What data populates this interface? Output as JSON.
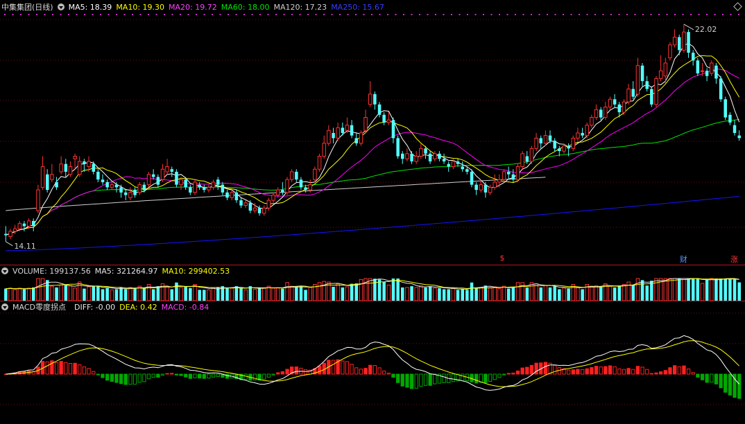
{
  "stock": {
    "name": "中集集团",
    "period": "(日线)"
  },
  "colors": {
    "bg": "#000000",
    "up": "#ff3232",
    "down": "#54ffff",
    "grid": "#7a0d12",
    "ma5": "#ffffff",
    "ma10": "#ffff00",
    "ma20": "#ff00ff",
    "ma60": "#00e600",
    "ma120": "#d0d0d0",
    "ma250": "#1414ff",
    "macd_up": "#ff2020",
    "macd_down": "#00a800",
    "diff": "#ffffff",
    "dea": "#ffff00"
  },
  "price_legend": [
    {
      "label": "MA5: 18.39",
      "color": "#ffffff"
    },
    {
      "label": "MA10: 19.30",
      "color": "#ffff00"
    },
    {
      "label": "MA20: 19.72",
      "color": "#ff40ff"
    },
    {
      "label": "MA60: 18.00",
      "color": "#00e600"
    },
    {
      "label": "MA120: 17.23",
      "color": "#d0d0d0"
    },
    {
      "label": "MA250: 15.67",
      "color": "#3c3cff"
    }
  ],
  "volume_legend": {
    "title": "VOLUME: 199137.56",
    "ma5": "MA5: 321264.97",
    "ma10": "MA10: 299402.53"
  },
  "macd_legend": {
    "title": "MACD零度拐点",
    "diff": "DIFF: -0.00",
    "dea": "DEA: 0.42",
    "macd": "MACD: -0.84"
  },
  "markers": {
    "high_label": "22.02",
    "low_label": "14.11"
  },
  "event_chips": [
    {
      "text": "$",
      "color": "#ff3232",
      "ci": 108
    },
    {
      "text": "财",
      "color": "#5a96ff",
      "ci": 147
    },
    {
      "text": "涨",
      "color": "#ff3232",
      "ci": 158
    }
  ],
  "chart_data": {
    "type": "candlestick",
    "title": "中集集团(日线)",
    "price_range": [
      13.5,
      23.0
    ],
    "candles": [
      [
        14.5,
        14.45,
        14.8,
        14.2
      ],
      [
        14.4,
        14.6,
        14.7,
        14.3
      ],
      [
        14.6,
        14.7,
        14.85,
        14.5
      ],
      [
        14.7,
        14.9,
        15.0,
        14.6
      ],
      [
        14.9,
        14.8,
        15.0,
        14.6
      ],
      [
        14.8,
        15.0,
        15.1,
        14.7
      ],
      [
        15.0,
        14.8,
        15.1,
        14.6
      ],
      [
        15.4,
        16.2,
        16.4,
        15.3
      ],
      [
        16.3,
        17.1,
        17.5,
        16.2
      ],
      [
        16.8,
        16.2,
        17.0,
        16.1
      ],
      [
        16.6,
        16.8,
        17.2,
        16.5
      ],
      [
        16.5,
        16.3,
        16.7,
        16.2
      ],
      [
        16.9,
        17.2,
        17.5,
        16.8
      ],
      [
        17.2,
        16.9,
        17.4,
        16.7
      ],
      [
        16.8,
        17.1,
        17.3,
        16.7
      ],
      [
        17.4,
        17.5,
        17.6,
        17.0
      ],
      [
        16.8,
        17.3,
        17.5,
        16.7
      ],
      [
        17.3,
        17.2,
        17.4,
        16.9
      ],
      [
        17.1,
        17.3,
        17.5,
        16.9
      ],
      [
        17.2,
        16.9,
        17.3,
        16.8
      ],
      [
        16.9,
        16.6,
        17.0,
        16.5
      ],
      [
        16.6,
        16.5,
        16.8,
        16.4
      ],
      [
        16.5,
        16.3,
        16.6,
        16.2
      ],
      [
        16.3,
        16.4,
        16.5,
        16.2
      ],
      [
        16.4,
        16.3,
        16.5,
        16.1
      ],
      [
        16.3,
        16.1,
        16.4,
        15.9
      ],
      [
        16.1,
        16.0,
        16.2,
        15.8
      ],
      [
        15.9,
        16.1,
        16.3,
        15.8
      ],
      [
        16.2,
        16.0,
        16.3,
        15.9
      ],
      [
        16.1,
        16.4,
        16.5,
        16.0
      ],
      [
        16.4,
        16.2,
        16.5,
        16.1
      ],
      [
        16.4,
        16.8,
        16.9,
        16.3
      ],
      [
        16.8,
        16.7,
        17.0,
        16.6
      ],
      [
        16.7,
        16.4,
        16.8,
        16.3
      ],
      [
        16.6,
        17.0,
        17.2,
        16.5
      ],
      [
        16.9,
        17.1,
        17.4,
        16.8
      ],
      [
        17.0,
        16.9,
        17.1,
        16.7
      ],
      [
        16.9,
        16.4,
        17.0,
        16.3
      ],
      [
        16.4,
        16.6,
        16.7,
        16.2
      ],
      [
        16.6,
        16.3,
        16.7,
        16.2
      ],
      [
        16.3,
        16.1,
        16.4,
        16.0
      ],
      [
        16.1,
        16.5,
        16.6,
        16.0
      ],
      [
        16.4,
        16.3,
        16.5,
        16.2
      ],
      [
        16.3,
        16.2,
        16.4,
        16.1
      ],
      [
        16.2,
        16.3,
        16.4,
        16.1
      ],
      [
        16.3,
        16.5,
        16.6,
        16.2
      ],
      [
        16.6,
        16.4,
        16.7,
        16.2
      ],
      [
        16.4,
        16.1,
        16.5,
        16.0
      ],
      [
        16.1,
        15.9,
        16.2,
        15.8
      ],
      [
        15.9,
        16.1,
        16.2,
        15.8
      ],
      [
        16.1,
        15.8,
        16.2,
        15.7
      ],
      [
        15.8,
        15.6,
        15.9,
        15.5
      ],
      [
        15.6,
        15.7,
        15.8,
        15.5
      ],
      [
        15.7,
        15.4,
        15.8,
        15.3
      ],
      [
        15.4,
        15.5,
        15.7,
        15.3
      ],
      [
        15.5,
        15.3,
        15.6,
        15.2
      ],
      [
        15.3,
        15.5,
        15.6,
        15.2
      ],
      [
        15.5,
        15.8,
        15.9,
        15.4
      ],
      [
        15.8,
        16.0,
        16.1,
        15.7
      ],
      [
        16.0,
        16.2,
        16.3,
        15.9
      ],
      [
        16.2,
        16.1,
        16.5,
        16.0
      ],
      [
        16.1,
        16.6,
        16.7,
        16.0
      ],
      [
        16.6,
        16.9,
        17.0,
        16.5
      ],
      [
        16.9,
        16.6,
        17.0,
        16.5
      ],
      [
        16.6,
        16.3,
        16.7,
        16.2
      ],
      [
        16.3,
        16.2,
        16.4,
        16.1
      ],
      [
        16.2,
        16.4,
        16.6,
        16.1
      ],
      [
        16.6,
        17.0,
        17.1,
        16.5
      ],
      [
        17.0,
        17.5,
        17.6,
        16.9
      ],
      [
        17.5,
        18.0,
        18.3,
        17.4
      ],
      [
        18.0,
        18.5,
        18.7,
        17.9
      ],
      [
        18.4,
        18.2,
        18.6,
        18.0
      ],
      [
        18.2,
        18.6,
        18.8,
        18.1
      ],
      [
        18.6,
        18.4,
        18.8,
        18.3
      ],
      [
        18.5,
        18.7,
        19.0,
        18.4
      ],
      [
        18.7,
        18.3,
        18.9,
        18.2
      ],
      [
        18.2,
        18.0,
        18.4,
        17.9
      ],
      [
        18.0,
        18.4,
        18.5,
        17.9
      ],
      [
        18.5,
        19.0,
        19.3,
        18.4
      ],
      [
        19.5,
        19.9,
        20.4,
        19.4
      ],
      [
        19.9,
        19.5,
        20.0,
        19.3
      ],
      [
        19.5,
        19.1,
        19.6,
        19.0
      ],
      [
        19.1,
        18.8,
        19.2,
        18.7
      ],
      [
        18.8,
        18.9,
        19.2,
        18.7
      ],
      [
        18.9,
        18.2,
        19.0,
        18.0
      ],
      [
        18.2,
        17.5,
        18.3,
        17.4
      ],
      [
        17.6,
        17.4,
        17.7,
        17.2
      ],
      [
        17.4,
        17.6,
        17.8,
        17.3
      ],
      [
        17.6,
        17.3,
        17.7,
        17.2
      ],
      [
        17.3,
        17.5,
        17.7,
        17.2
      ],
      [
        17.5,
        17.8,
        18.0,
        17.4
      ],
      [
        17.8,
        17.6,
        17.9,
        17.4
      ],
      [
        17.6,
        17.3,
        17.7,
        17.2
      ],
      [
        17.4,
        17.6,
        17.7,
        17.3
      ],
      [
        17.6,
        17.4,
        17.7,
        17.3
      ],
      [
        17.4,
        17.3,
        17.6,
        17.2
      ],
      [
        17.2,
        17.1,
        17.3,
        16.9
      ],
      [
        17.1,
        17.3,
        17.4,
        17.0
      ],
      [
        17.3,
        17.2,
        17.4,
        17.1
      ],
      [
        17.1,
        17.0,
        17.3,
        16.9
      ],
      [
        17.0,
        16.9,
        17.1,
        16.8
      ],
      [
        16.9,
        16.4,
        17.0,
        16.3
      ],
      [
        16.4,
        16.2,
        16.5,
        16.0
      ],
      [
        16.2,
        16.4,
        16.6,
        16.1
      ],
      [
        16.4,
        16.1,
        16.5,
        15.9
      ],
      [
        16.1,
        16.3,
        16.4,
        16.0
      ],
      [
        16.3,
        16.5,
        16.8,
        16.2
      ],
      [
        16.5,
        16.6,
        16.8,
        16.3
      ],
      [
        16.6,
        16.9,
        17.0,
        16.5
      ],
      [
        16.9,
        16.8,
        17.1,
        16.6
      ],
      [
        16.8,
        16.6,
        17.0,
        16.5
      ],
      [
        16.6,
        17.1,
        17.2,
        16.5
      ],
      [
        17.1,
        17.6,
        17.7,
        17.0
      ],
      [
        17.5,
        17.3,
        17.7,
        17.2
      ],
      [
        17.3,
        17.8,
        17.9,
        17.2
      ],
      [
        17.8,
        18.2,
        18.4,
        17.7
      ],
      [
        18.2,
        18.0,
        18.3,
        17.8
      ],
      [
        18.0,
        18.3,
        18.5,
        17.9
      ],
      [
        18.3,
        18.1,
        18.5,
        18.0
      ],
      [
        18.1,
        17.8,
        18.2,
        17.7
      ],
      [
        17.8,
        17.7,
        17.9,
        17.5
      ],
      [
        17.7,
        17.9,
        18.0,
        17.6
      ],
      [
        17.9,
        17.8,
        18.0,
        17.5
      ],
      [
        17.8,
        18.2,
        18.3,
        17.7
      ],
      [
        18.2,
        18.4,
        18.6,
        18.1
      ],
      [
        18.4,
        18.3,
        18.6,
        18.2
      ],
      [
        18.3,
        18.7,
        18.8,
        18.2
      ],
      [
        18.7,
        19.0,
        19.1,
        18.6
      ],
      [
        19.0,
        19.3,
        19.5,
        18.9
      ],
      [
        19.3,
        19.0,
        19.4,
        18.9
      ],
      [
        19.0,
        19.4,
        19.6,
        18.9
      ],
      [
        19.4,
        19.7,
        19.8,
        19.3
      ],
      [
        19.7,
        19.5,
        19.9,
        19.4
      ],
      [
        19.5,
        19.2,
        19.6,
        19.0
      ],
      [
        19.2,
        19.6,
        19.7,
        19.1
      ],
      [
        19.6,
        20.1,
        20.3,
        19.5
      ],
      [
        20.1,
        19.8,
        20.4,
        19.7
      ],
      [
        19.9,
        21.0,
        21.3,
        19.8
      ],
      [
        21.0,
        20.4,
        21.1,
        20.2
      ],
      [
        20.4,
        20.1,
        20.6,
        20.0
      ],
      [
        20.1,
        19.5,
        20.2,
        19.4
      ],
      [
        19.5,
        20.5,
        20.6,
        19.4
      ],
      [
        20.5,
        20.8,
        21.4,
        20.4
      ],
      [
        20.6,
        21.1,
        21.3,
        20.3
      ],
      [
        21.3,
        21.8,
        21.9,
        21.2
      ],
      [
        21.8,
        22.1,
        22.4,
        21.7
      ],
      [
        22.1,
        21.6,
        22.2,
        21.4
      ],
      [
        21.6,
        22.3,
        22.6,
        21.5
      ],
      [
        22.3,
        21.5,
        22.4,
        21.3
      ],
      [
        21.5,
        21.2,
        21.6,
        21.0
      ],
      [
        21.2,
        20.7,
        21.3,
        20.6
      ],
      [
        20.8,
        20.8,
        21.1,
        20.6
      ],
      [
        20.8,
        20.6,
        20.9,
        20.4
      ],
      [
        20.7,
        21.1,
        21.2,
        20.6
      ],
      [
        21.0,
        20.5,
        21.1,
        20.3
      ],
      [
        20.5,
        19.7,
        20.6,
        19.6
      ],
      [
        19.7,
        19.0,
        19.8,
        18.9
      ],
      [
        19.1,
        18.8,
        19.2,
        18.7
      ],
      [
        18.7,
        18.4,
        18.9,
        18.3
      ],
      [
        18.3,
        18.2,
        18.5,
        18.1
      ]
    ]
  }
}
